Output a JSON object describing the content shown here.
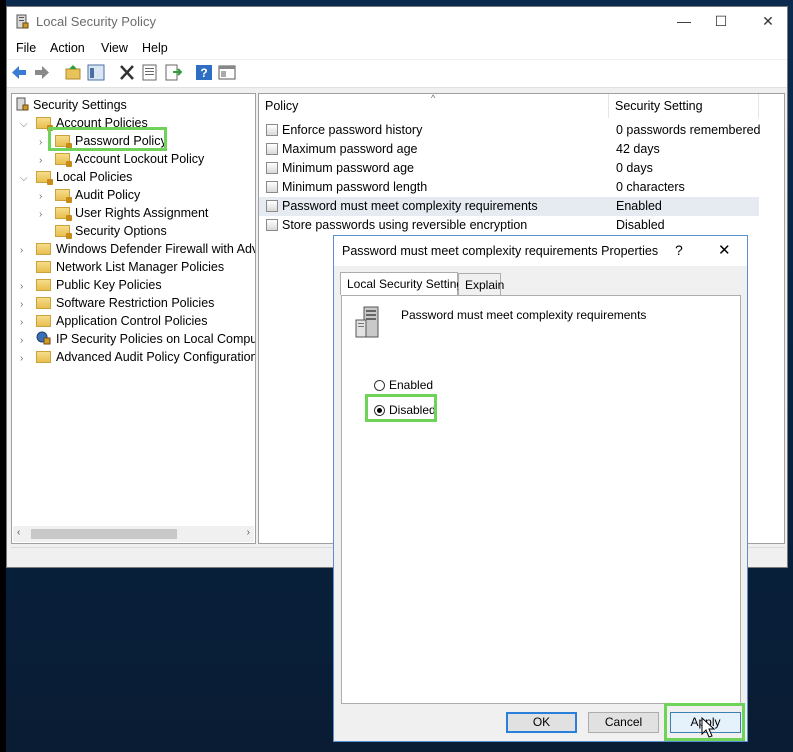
{
  "window": {
    "title": "Local Security Policy",
    "controls": {
      "minimize": "—",
      "maximize": "☐",
      "close": "✕"
    }
  },
  "menu": [
    "File",
    "Action",
    "View",
    "Help"
  ],
  "tree": {
    "root": "Security Settings",
    "items": [
      {
        "label": "Account Policies"
      },
      {
        "label": "Password Policy"
      },
      {
        "label": "Account Lockout Policy"
      },
      {
        "label": "Local Policies"
      },
      {
        "label": "Audit Policy"
      },
      {
        "label": "User Rights Assignment"
      },
      {
        "label": "Security Options"
      },
      {
        "label": "Windows Defender Firewall with Adva"
      },
      {
        "label": "Network List Manager Policies"
      },
      {
        "label": "Public Key Policies"
      },
      {
        "label": "Software Restriction Policies"
      },
      {
        "label": "Application Control Policies"
      },
      {
        "label": "IP Security Policies on Local Compute"
      },
      {
        "label": "Advanced Audit Policy Configuration"
      }
    ]
  },
  "list": {
    "columns": [
      "Policy",
      "Security Setting"
    ],
    "rows": [
      {
        "policy": "Enforce password history",
        "setting": "0 passwords remembered"
      },
      {
        "policy": "Maximum password age",
        "setting": "42 days"
      },
      {
        "policy": "Minimum password age",
        "setting": "0 days"
      },
      {
        "policy": "Minimum password length",
        "setting": "0 characters"
      },
      {
        "policy": "Password must meet complexity requirements",
        "setting": "Enabled"
      },
      {
        "policy": "Store passwords using reversible encryption",
        "setting": "Disabled"
      }
    ]
  },
  "dialog": {
    "title": "Password must meet complexity requirements Properties",
    "help": "?",
    "close": "✕",
    "tabs": [
      "Local Security Setting",
      "Explain"
    ],
    "policy_name": "Password must meet complexity requirements",
    "options": {
      "enabled": "Enabled",
      "disabled": "Disabled",
      "selected": "Disabled"
    },
    "buttons": {
      "ok": "OK",
      "cancel": "Cancel",
      "apply": "Apply"
    }
  },
  "colors": {
    "highlight": "#6fd35a",
    "selection": "#e5ebf1",
    "accent": "#2a7fd9"
  }
}
